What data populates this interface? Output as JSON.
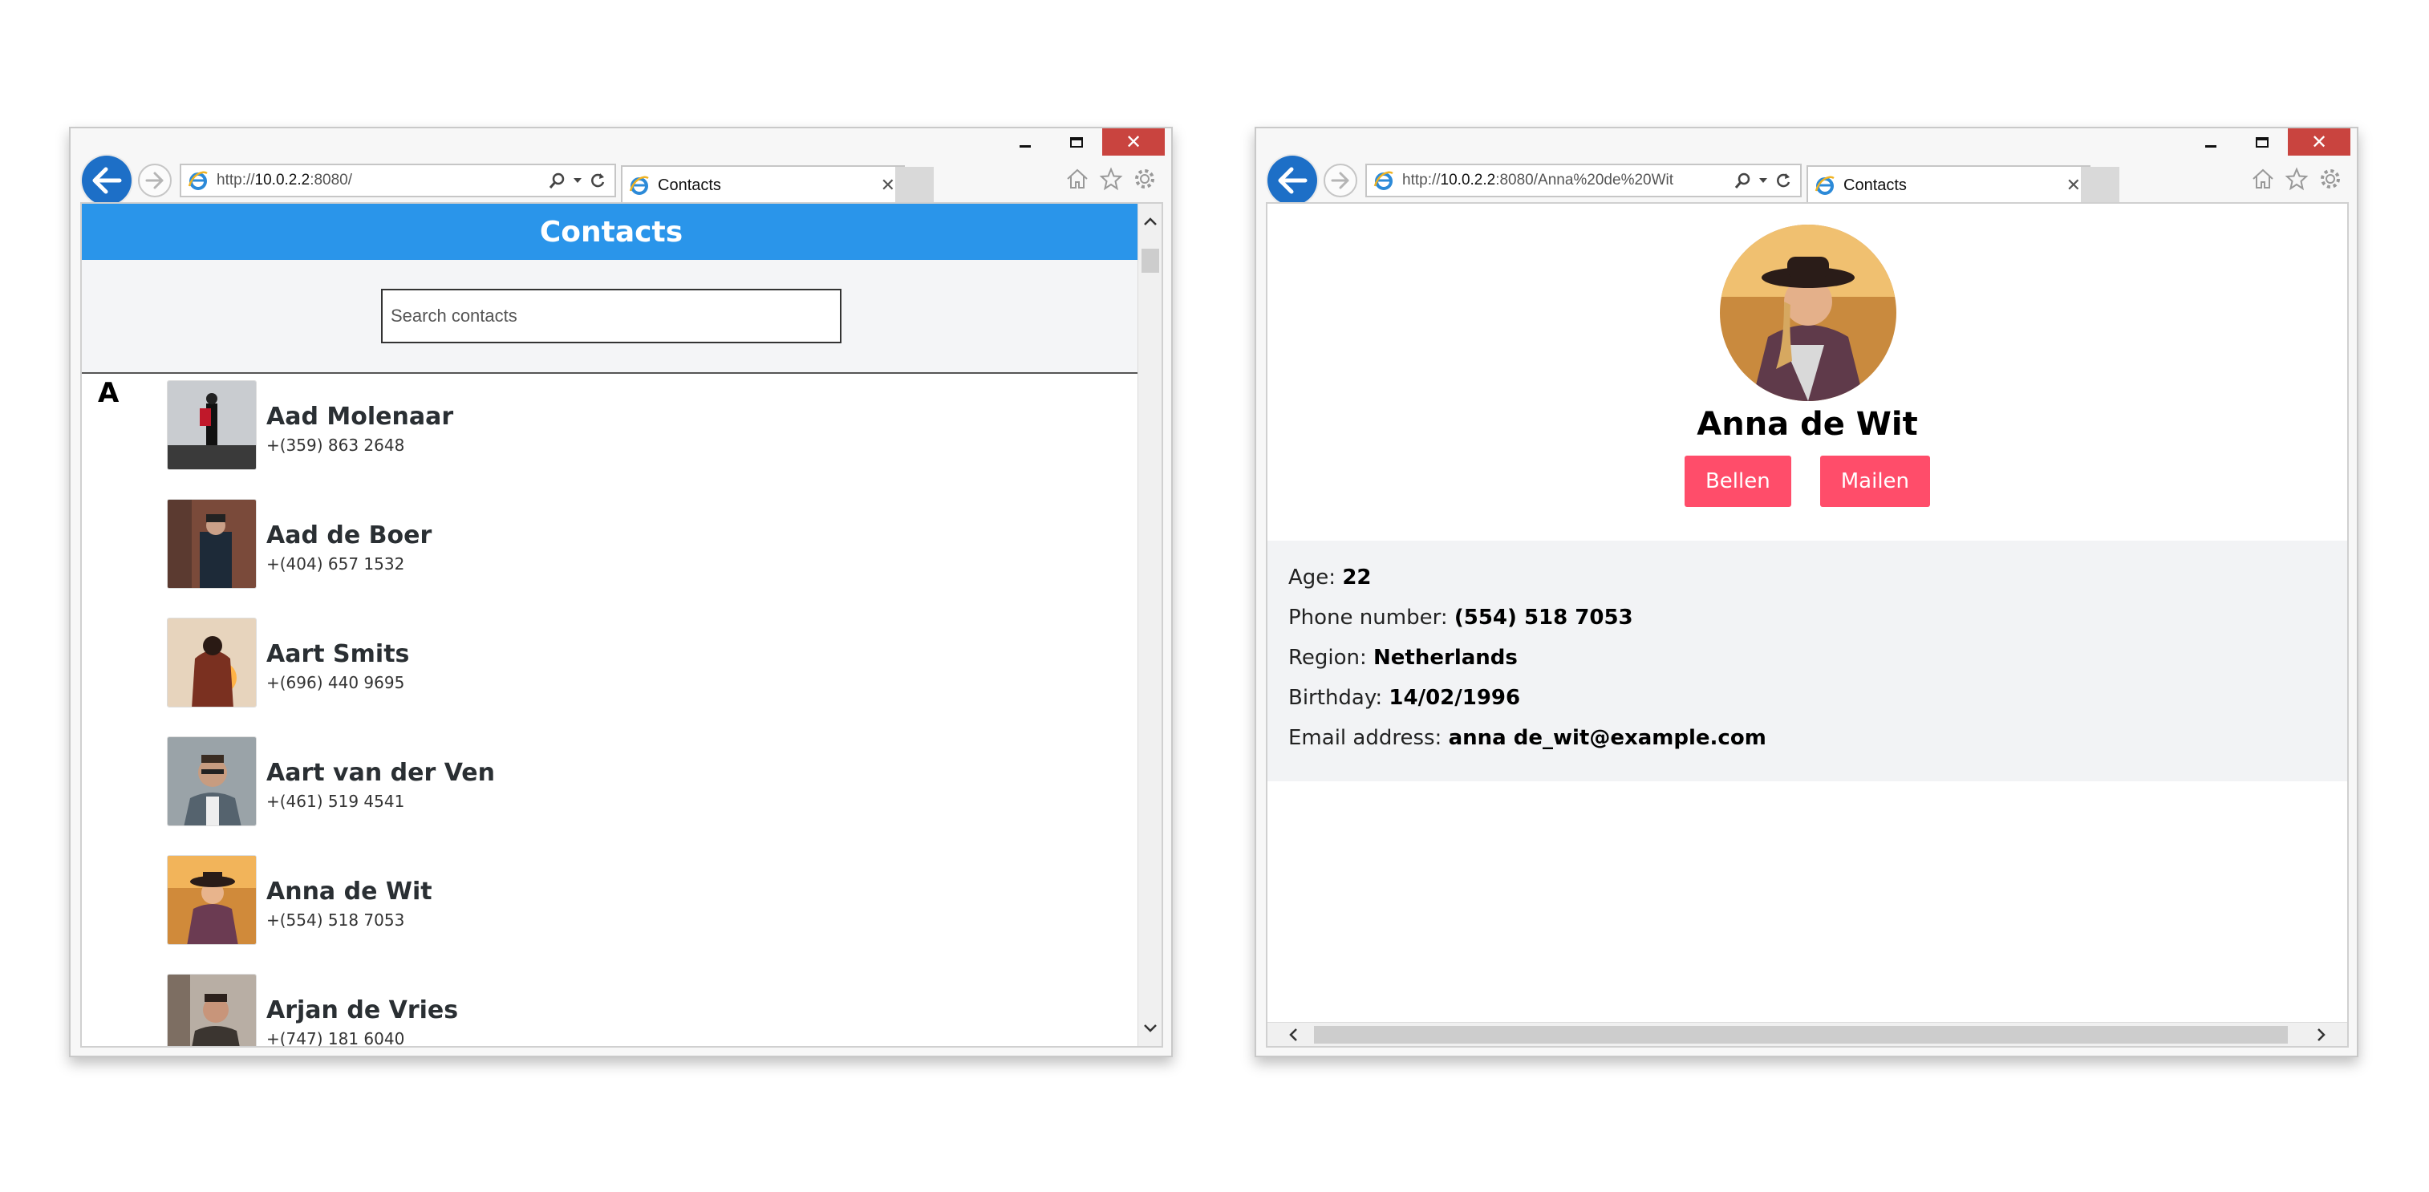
{
  "left_window": {
    "address_prefix": "http://",
    "address_host": "10.0.2.2",
    "address_rest": ":8080/",
    "tab_title": "Contacts",
    "page": {
      "header_title": "Contacts",
      "search_placeholder": "Search contacts",
      "group_letter": "A",
      "contacts": [
        {
          "name": "Aad Molenaar",
          "phone": "+(359) 863 2648"
        },
        {
          "name": "Aad de Boer",
          "phone": "+(404) 657 1532"
        },
        {
          "name": "Aart Smits",
          "phone": "+(696) 440 9695"
        },
        {
          "name": "Aart van der Ven",
          "phone": "+(461) 519 4541"
        },
        {
          "name": "Anna de Wit",
          "phone": "+(554) 518 7053"
        },
        {
          "name": "Arjan de Vries",
          "phone": "+(747) 181 6040"
        }
      ]
    }
  },
  "right_window": {
    "address_prefix": "http://",
    "address_host": "10.0.2.2",
    "address_rest": ":8080/Anna%20de%20Wit",
    "tab_title": "Contacts",
    "page": {
      "name": "Anna de Wit",
      "call_label": "Bellen",
      "mail_label": "Mailen",
      "details": {
        "age_label": "Age: ",
        "age_value": "22",
        "phone_label": "Phone number: ",
        "phone_value": "(554) 518 7053",
        "region_label": "Region: ",
        "region_value": "Netherlands",
        "birthday_label": "Birthday: ",
        "birthday_value": "14/02/1996",
        "email_label": "Email address: ",
        "email_value": "anna de_wit@example.com"
      }
    }
  },
  "window_controls": {
    "minimize": "–",
    "maximize": "□",
    "close": "✕"
  },
  "colors": {
    "header_blue": "#2a95ea",
    "action_pink": "#ff4d6a",
    "close_red": "#c9443f",
    "back_blue": "#1d6fc7"
  },
  "icons": [
    "back-arrow-icon",
    "forward-arrow-icon",
    "ie-logo-icon",
    "search-icon",
    "dropdown-icon",
    "refresh-icon",
    "tab-close-icon",
    "home-icon",
    "star-icon",
    "gear-icon"
  ]
}
